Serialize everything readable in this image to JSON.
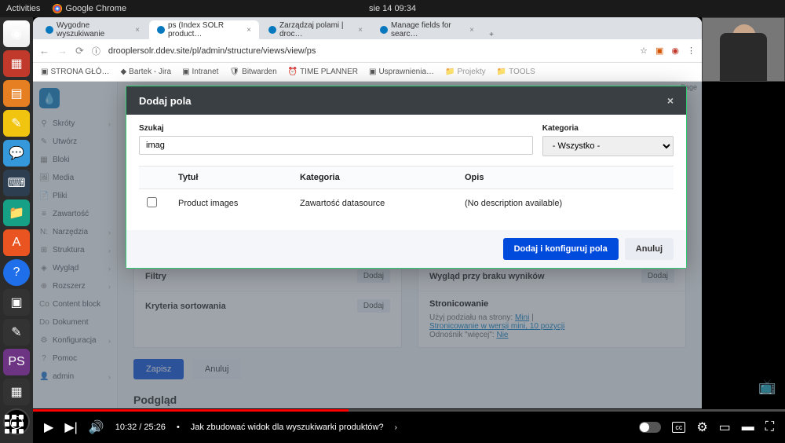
{
  "ubuntu": {
    "activities": "Activities",
    "app": "Google Chrome",
    "clock": "sie 14  09:34"
  },
  "chrome": {
    "tabs": [
      "Wygodne wyszukiwanie",
      "ps (Index SOLR product…",
      "Zarządzaj polami | droc…",
      "Manage fields for searc…"
    ],
    "url": "drooplersolr.ddev.site/pl/admin/structure/views/view/ps",
    "bookmarks": [
      "STRONA GŁÓ…",
      "Bartek - Jira",
      "Intranet",
      "Bitwarden",
      "TIME PLANNER",
      "Usprawnienia…",
      "Projekty",
      "TOOLS"
    ]
  },
  "admin_sidebar": {
    "items": [
      "Skróty",
      "Utwórz",
      "Bloki",
      "Media",
      "Pliki",
      "Zawartość",
      "Narzędzia",
      "Struktura",
      "Wygląd",
      "Rozszerz",
      "Content block",
      "Dokument",
      "Konfiguracja",
      "Pomoc",
      "admin"
    ],
    "prefixes": [
      "",
      "",
      "",
      "",
      "",
      "",
      "N:",
      "",
      "",
      "",
      "Co",
      "Do",
      "",
      "",
      ""
    ]
  },
  "view_page": {
    "filters": "Filtry",
    "sort": "Kryteria sortowania",
    "add": "Dodaj",
    "no_results": "Wygląd przy braku wyników",
    "pager_title": "Stronicowanie",
    "pager_line1a": "Użyj podziału na strony:",
    "pager_line1b": "Mini",
    "pager_line2": "Stronicowanie w wersji mini, 10 pozycji",
    "pager_line3a": "Odnośnik \"więcej\":",
    "pager_line3b": "Nie",
    "save": "Zapisz",
    "cancel": "Anuluj",
    "preview": "Podgląd",
    "page_label": "Page"
  },
  "modal": {
    "title": "Dodaj pola",
    "search_label": "Szukaj",
    "search_value": "imag",
    "category_label": "Kategoria",
    "category_value": "- Wszystko -",
    "col_title": "Tytuł",
    "col_category": "Kategoria",
    "col_desc": "Opis",
    "row_title": "Product images",
    "row_category": "Zawartość datasource",
    "row_desc": "(No description available)",
    "submit": "Dodaj i konfiguruj pola",
    "cancel": "Anuluj"
  },
  "youtube": {
    "time": "10:32 / 25:26",
    "chapter": "Jak zbudować widok dla wyszukiwarki produktów?",
    "cc": "cc"
  }
}
